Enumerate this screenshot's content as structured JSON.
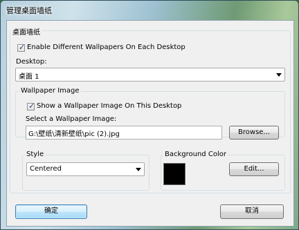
{
  "window": {
    "title": "管理桌面墙纸"
  },
  "main_group": {
    "legend": "桌面墙纸"
  },
  "enable_different": {
    "label": "Enable Different Wallpapers On Each Desktop",
    "checked": true
  },
  "desktop": {
    "label": "Desktop:",
    "selected": "桌面 1"
  },
  "wallpaper_group": {
    "legend": "Wallpaper Image",
    "show_label": "Show a Wallpaper Image On This Desktop",
    "show_checked": true,
    "select_label": "Select a Wallpaper Image:",
    "path": "G:\\壁纸\\清新壁纸\\pic (2).jpg",
    "browse_label": "Browse..."
  },
  "style_group": {
    "legend": "Style",
    "selected": "Centered"
  },
  "bgcolor_group": {
    "legend": "Background Color",
    "color": "#000000",
    "edit_label": "Edit..."
  },
  "buttons": {
    "ok": "确定",
    "cancel": "取消"
  }
}
